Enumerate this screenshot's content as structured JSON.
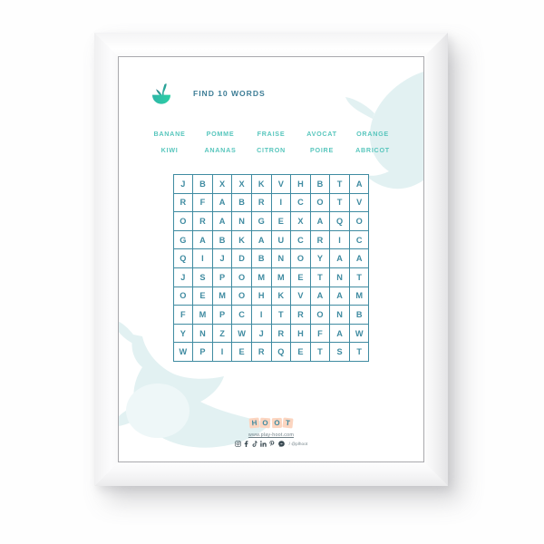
{
  "poster": {
    "header": {
      "logo_icon": "whale-tail-icon",
      "title": "FIND 10 WORDS"
    },
    "word_list": {
      "rows": [
        [
          "BANANE",
          "POMME",
          "FRAISE",
          "AVOCAT",
          "ORANGE"
        ],
        [
          "KIWI",
          "ANANAS",
          "CITRON",
          "POIRE",
          "ABRICOT"
        ]
      ]
    },
    "grid": {
      "columns": 10,
      "rows": 10,
      "letters": [
        [
          "J",
          "B",
          "X",
          "X",
          "K",
          "V",
          "H",
          "B",
          "T",
          "A"
        ],
        [
          "R",
          "F",
          "A",
          "B",
          "R",
          "I",
          "C",
          "O",
          "T",
          "V"
        ],
        [
          "O",
          "R",
          "A",
          "N",
          "G",
          "E",
          "X",
          "A",
          "Q",
          "O"
        ],
        [
          "G",
          "A",
          "B",
          "K",
          "A",
          "U",
          "C",
          "R",
          "I",
          "C"
        ],
        [
          "Q",
          "I",
          "J",
          "D",
          "B",
          "N",
          "O",
          "Y",
          "A",
          "A"
        ],
        [
          "J",
          "S",
          "P",
          "O",
          "M",
          "M",
          "E",
          "T",
          "N",
          "T"
        ],
        [
          "O",
          "E",
          "M",
          "O",
          "H",
          "K",
          "V",
          "A",
          "A",
          "M"
        ],
        [
          "F",
          "M",
          "P",
          "C",
          "I",
          "T",
          "R",
          "O",
          "N",
          "B"
        ],
        [
          "Y",
          "N",
          "Z",
          "W",
          "J",
          "R",
          "H",
          "F",
          "A",
          "W"
        ],
        [
          "W",
          "P",
          "I",
          "E",
          "R",
          "Q",
          "E",
          "T",
          "S",
          "T"
        ]
      ]
    },
    "footer": {
      "brand_letters": [
        "H",
        "O",
        "O",
        "T"
      ],
      "url": "www.play-hoot.com",
      "handle": "/ @plhoot",
      "social_icons": [
        "instagram-icon",
        "facebook-icon",
        "tiktok-icon",
        "linkedin-icon",
        "pinterest-icon",
        "messenger-icon"
      ]
    }
  },
  "colors": {
    "grid_teal": "#3f8ba1",
    "title_teal": "#3d7d96",
    "word_mint": "#58c6bd",
    "brand_peach": "#fcd5c0",
    "whale_pale": "#e2f1f2"
  }
}
